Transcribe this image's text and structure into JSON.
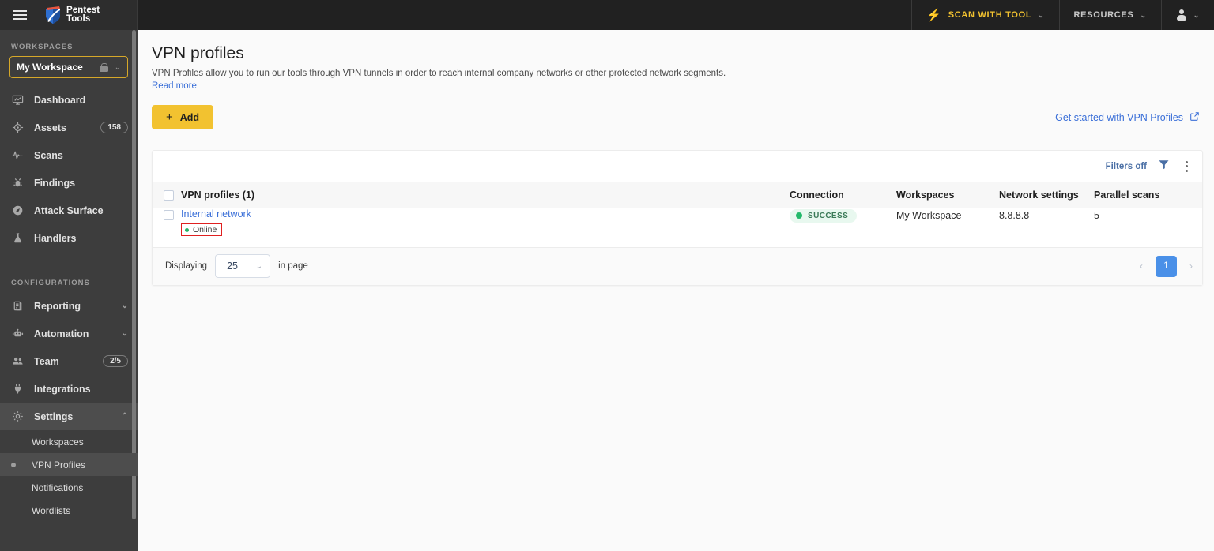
{
  "topbar": {
    "logo_text_line1": "Pentest",
    "logo_text_line2": "Tools",
    "scan_with_tool": "SCAN WITH TOOL",
    "resources": "RESOURCES",
    "caret": "⌄"
  },
  "sidebar": {
    "workspaces_label": "WORKSPACES",
    "workspace_name": "My Workspace",
    "nav": [
      {
        "label": "Dashboard",
        "icon": "dashboard-icon",
        "badge": "",
        "chevron": ""
      },
      {
        "label": "Assets",
        "icon": "target-icon",
        "badge": "158",
        "chevron": ""
      },
      {
        "label": "Scans",
        "icon": "pulse-icon",
        "badge": "",
        "chevron": ""
      },
      {
        "label": "Findings",
        "icon": "bug-icon",
        "badge": "",
        "chevron": ""
      },
      {
        "label": "Attack Surface",
        "icon": "compass-icon",
        "badge": "",
        "chevron": ""
      },
      {
        "label": "Handlers",
        "icon": "flask-icon",
        "badge": "",
        "chevron": ""
      }
    ],
    "configurations_label": "CONFIGURATIONS",
    "config_nav": [
      {
        "label": "Reporting",
        "icon": "clipboard-icon",
        "badge": "",
        "chevron": "⌄"
      },
      {
        "label": "Automation",
        "icon": "robot-icon",
        "badge": "",
        "chevron": "⌄"
      },
      {
        "label": "Team",
        "icon": "people-icon",
        "badge": "2/5",
        "chevron": ""
      },
      {
        "label": "Integrations",
        "icon": "plug-icon",
        "badge": "",
        "chevron": ""
      },
      {
        "label": "Settings",
        "icon": "gear-icon",
        "badge": "",
        "chevron": "⌃"
      }
    ],
    "settings_sub": [
      {
        "label": "Workspaces"
      },
      {
        "label": "VPN Profiles"
      },
      {
        "label": "Notifications"
      },
      {
        "label": "Wordlists"
      }
    ]
  },
  "main": {
    "title": "VPN profiles",
    "description": "VPN Profiles allow you to run our tools through VPN tunnels in order to reach internal company networks or other protected network segments.",
    "read_more": "Read more",
    "add_button": "Add",
    "add_plus": "+",
    "get_started": "Get started with VPN Profiles"
  },
  "table": {
    "filters_label": "Filters off",
    "headers": {
      "name": "VPN profiles (1)",
      "connection": "Connection",
      "workspaces": "Workspaces",
      "network_settings": "Network settings",
      "parallel_scans": "Parallel scans"
    },
    "rows": [
      {
        "name": "Internal network",
        "status": "Online",
        "connection": "SUCCESS",
        "workspace": "My Workspace",
        "network_settings": "8.8.8.8",
        "parallel_scans": "5"
      }
    ]
  },
  "footer": {
    "displaying_label": "Displaying",
    "page_size": "25",
    "in_page_label": "in page",
    "prev": "‹",
    "next": "›",
    "current_page": "1",
    "chevron": "⌄"
  },
  "colors": {
    "accent_yellow": "#f2c230",
    "link_blue": "#3a6fd8",
    "success_green": "#22b96a",
    "highlight_red": "#e02020",
    "sidebar_bg": "#3d3d3d",
    "topbar_bg": "#212121"
  }
}
